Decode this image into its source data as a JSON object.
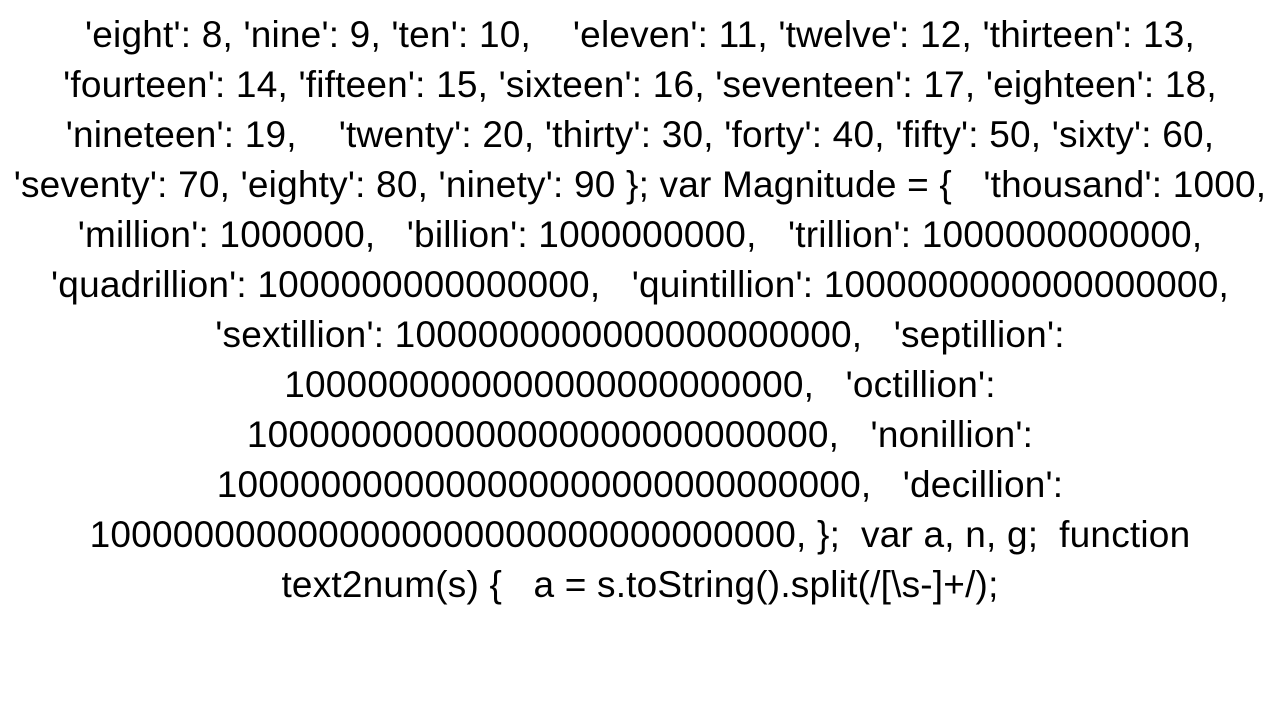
{
  "code_text": "'eight': 8, 'nine': 9, 'ten': 10,    'eleven': 11, 'twelve': 12, 'thirteen': 13, 'fourteen': 14, 'fifteen': 15, 'sixteen': 16, 'seventeen': 17, 'eighteen': 18, 'nineteen': 19,    'twenty': 20, 'thirty': 30, 'forty': 40, 'fifty': 50, 'sixty': 60, 'seventy': 70, 'eighty': 80, 'ninety': 90 }; var Magnitude = {   'thousand': 1000,   'million': 1000000,   'billion': 1000000000,   'trillion': 1000000000000,   'quadrillion': 1000000000000000,   'quintillion': 1000000000000000000,   'sextillion': 1000000000000000000000,   'septillion': 1000000000000000000000000,   'octillion': 1000000000000000000000000000,   'nonillion': 1000000000000000000000000000000,   'decillion': 1000000000000000000000000000000000, };  var a, n, g;  function text2num(s) {   a = s.toString().split(/[\\s-]+/);"
}
